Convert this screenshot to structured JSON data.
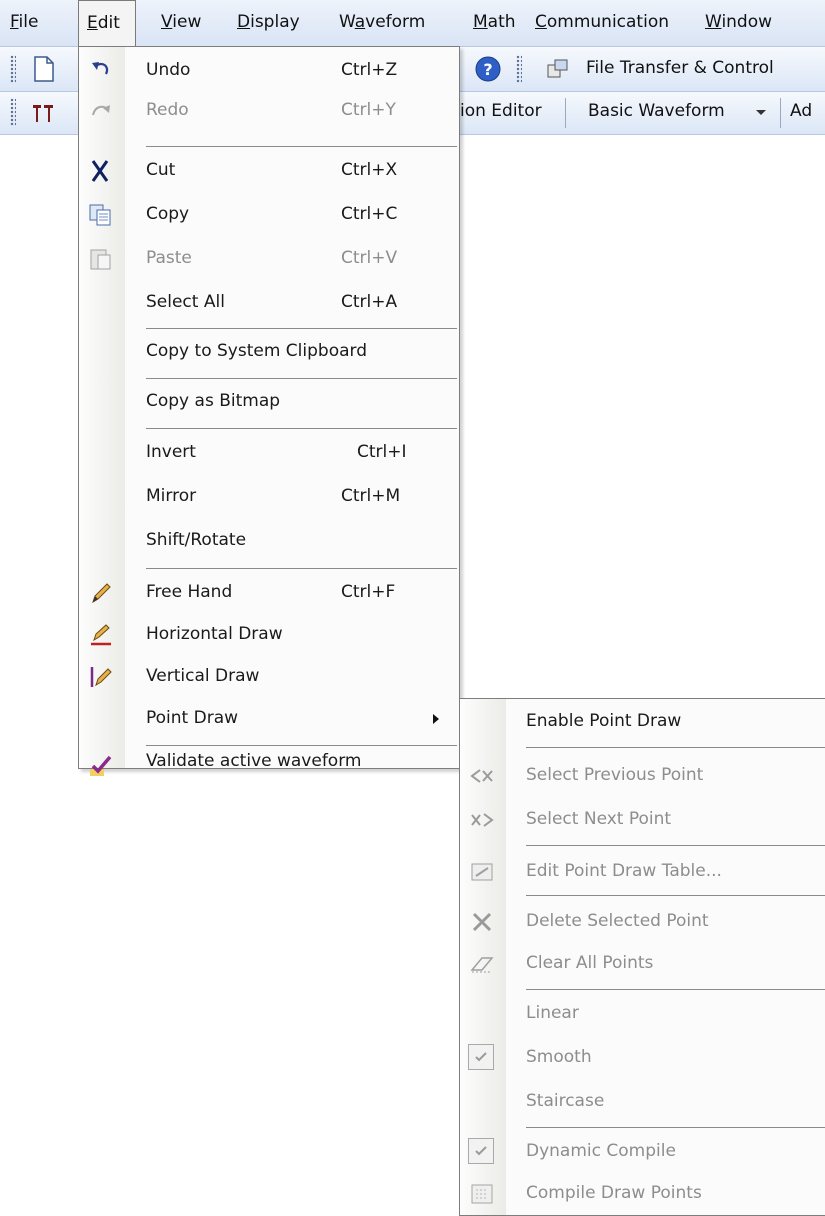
{
  "menubar": {
    "items": [
      {
        "pre": "",
        "u": "F",
        "post": "ile"
      },
      {
        "pre": "",
        "u": "E",
        "post": "dit"
      },
      {
        "pre": "",
        "u": "V",
        "post": "iew"
      },
      {
        "pre": "",
        "u": "D",
        "post": "isplay"
      },
      {
        "pre": "W",
        "u": "a",
        "post": "veform"
      },
      {
        "pre": "",
        "u": "M",
        "post": "ath"
      },
      {
        "pre": "",
        "u": "C",
        "post": "ommunication"
      },
      {
        "pre": "",
        "u": "W",
        "post": "indow"
      }
    ]
  },
  "toolbar1": {
    "file_transfer_label": "File Transfer & Control"
  },
  "toolbar2": {
    "partial_editor_label": "ion Editor",
    "basic_waveform_label": "Basic Waveform",
    "partial_right_label": "Ad"
  },
  "edit_menu": {
    "items": [
      {
        "label": "Undo",
        "shortcut": "Ctrl+Z",
        "icon": "undo-icon",
        "disabled": false
      },
      {
        "label": "Redo",
        "shortcut": "Ctrl+Y",
        "icon": "redo-icon",
        "disabled": true
      },
      {
        "label": "Cut",
        "shortcut": "Ctrl+X",
        "icon": "scissors-icon",
        "disabled": false
      },
      {
        "label": "Copy",
        "shortcut": "Ctrl+C",
        "icon": "copy-icon",
        "disabled": false
      },
      {
        "label": "Paste",
        "shortcut": "Ctrl+V",
        "icon": "paste-icon",
        "disabled": true
      },
      {
        "label": "Select All",
        "shortcut": "Ctrl+A",
        "icon": "",
        "disabled": false
      },
      {
        "label": "Copy to System Clipboard",
        "shortcut": "",
        "icon": "",
        "disabled": false
      },
      {
        "label": "Copy as Bitmap",
        "shortcut": "",
        "icon": "",
        "disabled": false
      },
      {
        "label": "Invert",
        "shortcut": "Ctrl+I",
        "icon": "",
        "disabled": false
      },
      {
        "label": "Mirror",
        "shortcut": "Ctrl+M",
        "icon": "",
        "disabled": false
      },
      {
        "label": "Shift/Rotate",
        "shortcut": "",
        "icon": "",
        "disabled": false
      },
      {
        "label": "Free Hand",
        "shortcut": "Ctrl+F",
        "icon": "pencil-icon",
        "disabled": false
      },
      {
        "label": "Horizontal Draw",
        "shortcut": "",
        "icon": "horizontal-pencil-icon",
        "disabled": false
      },
      {
        "label": "Vertical Draw",
        "shortcut": "",
        "icon": "vertical-pencil-icon",
        "disabled": false
      },
      {
        "label": "Point Draw",
        "shortcut": "",
        "icon": "",
        "disabled": false
      },
      {
        "label": "Validate active waveform",
        "shortcut": "",
        "icon": "checkmark-icon",
        "disabled": false
      }
    ]
  },
  "point_draw_submenu": {
    "items": [
      {
        "label": "Enable Point Draw",
        "icon": "",
        "disabled": false
      },
      {
        "label": "Select Previous Point",
        "icon": "previous-point-icon",
        "disabled": true
      },
      {
        "label": "Select Next Point",
        "icon": "next-point-icon",
        "disabled": true
      },
      {
        "label": "Edit Point Draw Table...",
        "icon": "table-icon",
        "disabled": true
      },
      {
        "label": "Delete Selected Point",
        "icon": "delete-point-icon",
        "disabled": true
      },
      {
        "label": "Clear All Points",
        "icon": "eraser-icon",
        "disabled": true
      },
      {
        "label": "Linear",
        "icon": "",
        "disabled": true
      },
      {
        "label": "Smooth",
        "icon": "check-icon",
        "disabled": true,
        "checked": true
      },
      {
        "label": "Staircase",
        "icon": "",
        "disabled": true
      },
      {
        "label": "Dynamic Compile",
        "icon": "check-icon",
        "disabled": true,
        "checked": true
      },
      {
        "label": "Compile Draw Points",
        "icon": "compile-icon",
        "disabled": true
      }
    ]
  },
  "colors": {
    "menubar_bg": "#d9e4f5",
    "menu_bg": "#fbfbfb",
    "disabled_text": "#8d8d8d"
  }
}
